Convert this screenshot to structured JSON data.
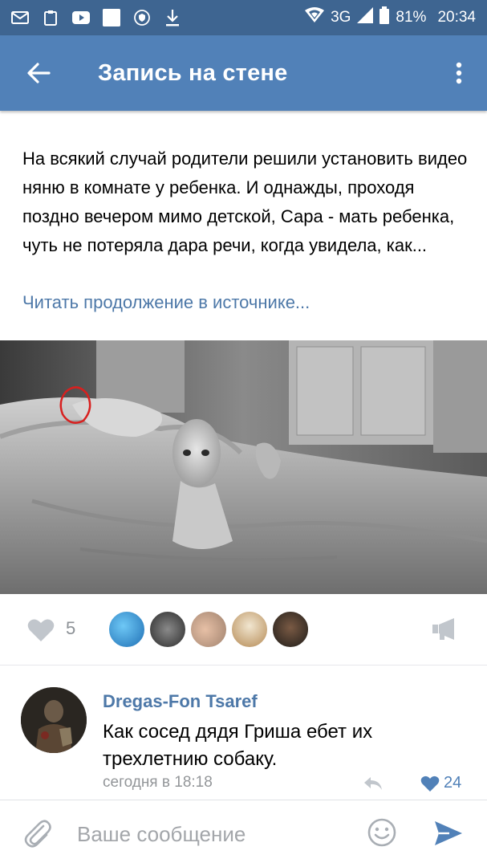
{
  "status_bar": {
    "network": "3G",
    "battery": "81%",
    "time": "20:34",
    "icons": [
      "mail-icon",
      "clipboard-icon",
      "youtube-icon",
      "blank-notification-icon",
      "vpn-shield-icon",
      "download-icon",
      "wifi-icon",
      "signal-icon",
      "battery-icon"
    ]
  },
  "toolbar": {
    "title": "Запись на стене",
    "back_icon": "arrow-left-icon",
    "menu_icon": "more-vertical-icon",
    "color": "#5181b8"
  },
  "post": {
    "text": "На всякий случай родители решили установить видео няню в комнате у ребенка. И однажды, проходя поздно вечером мимо детской, Сара - мать ребенка, чуть не потеряла дара речи, когда увидела, как...",
    "read_more": "Читать продолжение в источнике..."
  },
  "actions": {
    "like_count": "5",
    "like_icon": "heart-icon",
    "share_icon": "megaphone-icon"
  },
  "comment": {
    "author": "Dregas-Fon Tsaref",
    "text": "Как сосед дядя Гриша ебет их трехлетнию собаку.",
    "time": "сегодня в 18:18",
    "likes": "24"
  },
  "composer": {
    "placeholder": "Ваше сообщение",
    "value": ""
  },
  "colors": {
    "accent": "#5181b8",
    "link": "#4d78a8",
    "muted": "#939699"
  }
}
